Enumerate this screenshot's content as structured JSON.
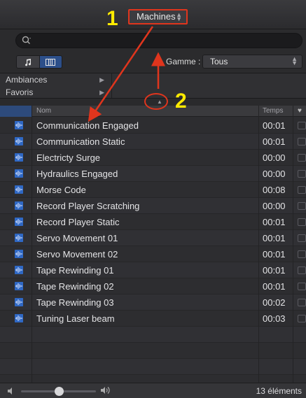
{
  "topbar": {
    "category": "Machines"
  },
  "search": {
    "placeholder": ""
  },
  "filter": {
    "range_label": "Gamme :",
    "range_value": "Tous"
  },
  "browser": {
    "items": [
      "Ambiances",
      "Favoris"
    ]
  },
  "table": {
    "headers": {
      "name": "Nom",
      "time": "Temps"
    },
    "rows": [
      {
        "name": "Communication Engaged",
        "time": "00:01"
      },
      {
        "name": "Communication Static",
        "time": "00:01"
      },
      {
        "name": "Electricty Surge",
        "time": "00:00"
      },
      {
        "name": "Hydraulics Engaged",
        "time": "00:00"
      },
      {
        "name": "Morse Code",
        "time": "00:08"
      },
      {
        "name": "Record Player Scratching",
        "time": "00:00"
      },
      {
        "name": "Record Player Static",
        "time": "00:01"
      },
      {
        "name": "Servo Movement 01",
        "time": "00:01"
      },
      {
        "name": "Servo Movement 02",
        "time": "00:01"
      },
      {
        "name": "Tape Rewinding 01",
        "time": "00:01"
      },
      {
        "name": "Tape Rewinding 02",
        "time": "00:01"
      },
      {
        "name": "Tape Rewinding 03",
        "time": "00:02"
      },
      {
        "name": "Tuning Laser beam",
        "time": "00:03"
      }
    ]
  },
  "footer": {
    "count": "13 éléments",
    "volume_level": 0.5
  },
  "annotations": {
    "label1": "1",
    "label2": "2"
  },
  "colors": {
    "accent": "#2c4f8a",
    "annotation": "#e0351d",
    "annotation_text": "#ffea00"
  },
  "icons": [
    "search-icon",
    "music-note-icon",
    "grid-view-icon",
    "waveform-icon",
    "heart-icon",
    "speaker-low-icon",
    "speaker-high-icon"
  ]
}
